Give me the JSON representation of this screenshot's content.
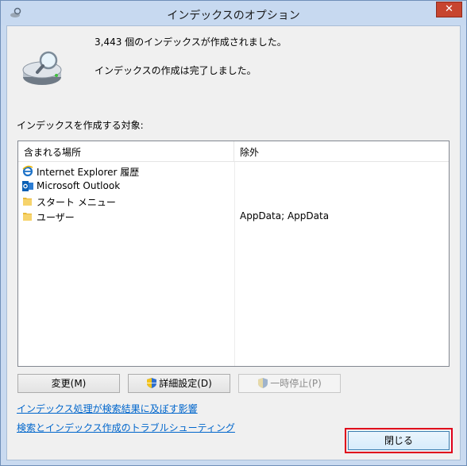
{
  "window": {
    "title": "インデックスのオプション",
    "close_glyph": "✕"
  },
  "status": {
    "count_text": "3,443 個のインデックスが作成されました。",
    "done_text": "インデックスの作成は完了しました。"
  },
  "section_label": "インデックスを作成する対象:",
  "list": {
    "columns": [
      "含まれる場所",
      "除外"
    ],
    "rows": [
      {
        "name": "Internet Explorer 履歴",
        "exclude": "",
        "icon": "internet-explorer-icon"
      },
      {
        "name": "Microsoft Outlook",
        "exclude": "",
        "icon": "outlook-icon"
      },
      {
        "name": "スタート メニュー",
        "exclude": "",
        "icon": "folder-icon"
      },
      {
        "name": "ユーザー",
        "exclude": "AppData; AppData",
        "icon": "folder-icon"
      }
    ]
  },
  "buttons": {
    "modify": "変更(M)",
    "advanced": "詳細設定(D)",
    "pause": "一時停止(P)",
    "close": "閉じる"
  },
  "links": {
    "affect_results": "インデックス処理が検索結果に及ぼす影響",
    "troubleshoot": "検索とインデックス作成のトラブルシューティング"
  },
  "colors": {
    "title_bar": "#c7d9f0",
    "close_button": "#c7452f",
    "link": "#0066cc",
    "highlight_border": "#e0001a"
  }
}
